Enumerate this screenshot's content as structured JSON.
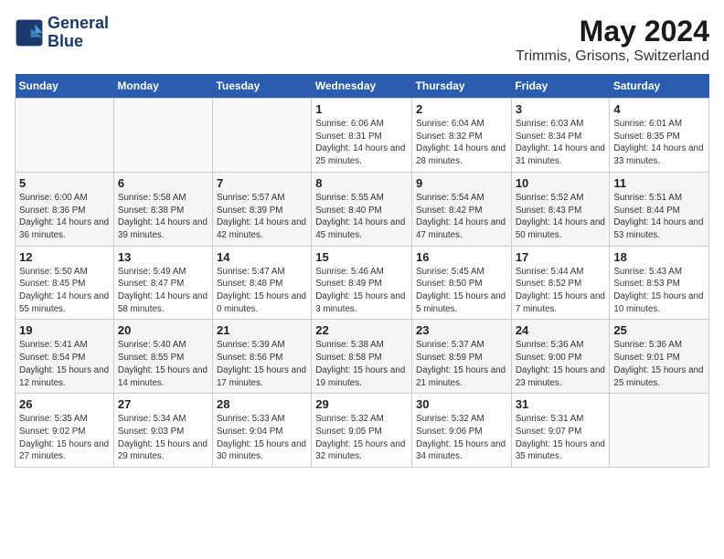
{
  "header": {
    "logo_line1": "General",
    "logo_line2": "Blue",
    "title": "May 2024",
    "subtitle": "Trimmis, Grisons, Switzerland"
  },
  "days_of_week": [
    "Sunday",
    "Monday",
    "Tuesday",
    "Wednesday",
    "Thursday",
    "Friday",
    "Saturday"
  ],
  "weeks": [
    [
      {
        "day": "",
        "info": ""
      },
      {
        "day": "",
        "info": ""
      },
      {
        "day": "",
        "info": ""
      },
      {
        "day": "1",
        "info": "Sunrise: 6:06 AM\nSunset: 8:31 PM\nDaylight: 14 hours\nand 25 minutes."
      },
      {
        "day": "2",
        "info": "Sunrise: 6:04 AM\nSunset: 8:32 PM\nDaylight: 14 hours\nand 28 minutes."
      },
      {
        "day": "3",
        "info": "Sunrise: 6:03 AM\nSunset: 8:34 PM\nDaylight: 14 hours\nand 31 minutes."
      },
      {
        "day": "4",
        "info": "Sunrise: 6:01 AM\nSunset: 8:35 PM\nDaylight: 14 hours\nand 33 minutes."
      }
    ],
    [
      {
        "day": "5",
        "info": "Sunrise: 6:00 AM\nSunset: 8:36 PM\nDaylight: 14 hours\nand 36 minutes."
      },
      {
        "day": "6",
        "info": "Sunrise: 5:58 AM\nSunset: 8:38 PM\nDaylight: 14 hours\nand 39 minutes."
      },
      {
        "day": "7",
        "info": "Sunrise: 5:57 AM\nSunset: 8:39 PM\nDaylight: 14 hours\nand 42 minutes."
      },
      {
        "day": "8",
        "info": "Sunrise: 5:55 AM\nSunset: 8:40 PM\nDaylight: 14 hours\nand 45 minutes."
      },
      {
        "day": "9",
        "info": "Sunrise: 5:54 AM\nSunset: 8:42 PM\nDaylight: 14 hours\nand 47 minutes."
      },
      {
        "day": "10",
        "info": "Sunrise: 5:52 AM\nSunset: 8:43 PM\nDaylight: 14 hours\nand 50 minutes."
      },
      {
        "day": "11",
        "info": "Sunrise: 5:51 AM\nSunset: 8:44 PM\nDaylight: 14 hours\nand 53 minutes."
      }
    ],
    [
      {
        "day": "12",
        "info": "Sunrise: 5:50 AM\nSunset: 8:45 PM\nDaylight: 14 hours\nand 55 minutes."
      },
      {
        "day": "13",
        "info": "Sunrise: 5:49 AM\nSunset: 8:47 PM\nDaylight: 14 hours\nand 58 minutes."
      },
      {
        "day": "14",
        "info": "Sunrise: 5:47 AM\nSunset: 8:48 PM\nDaylight: 15 hours\nand 0 minutes."
      },
      {
        "day": "15",
        "info": "Sunrise: 5:46 AM\nSunset: 8:49 PM\nDaylight: 15 hours\nand 3 minutes."
      },
      {
        "day": "16",
        "info": "Sunrise: 5:45 AM\nSunset: 8:50 PM\nDaylight: 15 hours\nand 5 minutes."
      },
      {
        "day": "17",
        "info": "Sunrise: 5:44 AM\nSunset: 8:52 PM\nDaylight: 15 hours\nand 7 minutes."
      },
      {
        "day": "18",
        "info": "Sunrise: 5:43 AM\nSunset: 8:53 PM\nDaylight: 15 hours\nand 10 minutes."
      }
    ],
    [
      {
        "day": "19",
        "info": "Sunrise: 5:41 AM\nSunset: 8:54 PM\nDaylight: 15 hours\nand 12 minutes."
      },
      {
        "day": "20",
        "info": "Sunrise: 5:40 AM\nSunset: 8:55 PM\nDaylight: 15 hours\nand 14 minutes."
      },
      {
        "day": "21",
        "info": "Sunrise: 5:39 AM\nSunset: 8:56 PM\nDaylight: 15 hours\nand 17 minutes."
      },
      {
        "day": "22",
        "info": "Sunrise: 5:38 AM\nSunset: 8:58 PM\nDaylight: 15 hours\nand 19 minutes."
      },
      {
        "day": "23",
        "info": "Sunrise: 5:37 AM\nSunset: 8:59 PM\nDaylight: 15 hours\nand 21 minutes."
      },
      {
        "day": "24",
        "info": "Sunrise: 5:36 AM\nSunset: 9:00 PM\nDaylight: 15 hours\nand 23 minutes."
      },
      {
        "day": "25",
        "info": "Sunrise: 5:36 AM\nSunset: 9:01 PM\nDaylight: 15 hours\nand 25 minutes."
      }
    ],
    [
      {
        "day": "26",
        "info": "Sunrise: 5:35 AM\nSunset: 9:02 PM\nDaylight: 15 hours\nand 27 minutes."
      },
      {
        "day": "27",
        "info": "Sunrise: 5:34 AM\nSunset: 9:03 PM\nDaylight: 15 hours\nand 29 minutes."
      },
      {
        "day": "28",
        "info": "Sunrise: 5:33 AM\nSunset: 9:04 PM\nDaylight: 15 hours\nand 30 minutes."
      },
      {
        "day": "29",
        "info": "Sunrise: 5:32 AM\nSunset: 9:05 PM\nDaylight: 15 hours\nand 32 minutes."
      },
      {
        "day": "30",
        "info": "Sunrise: 5:32 AM\nSunset: 9:06 PM\nDaylight: 15 hours\nand 34 minutes."
      },
      {
        "day": "31",
        "info": "Sunrise: 5:31 AM\nSunset: 9:07 PM\nDaylight: 15 hours\nand 35 minutes."
      },
      {
        "day": "",
        "info": ""
      }
    ]
  ]
}
